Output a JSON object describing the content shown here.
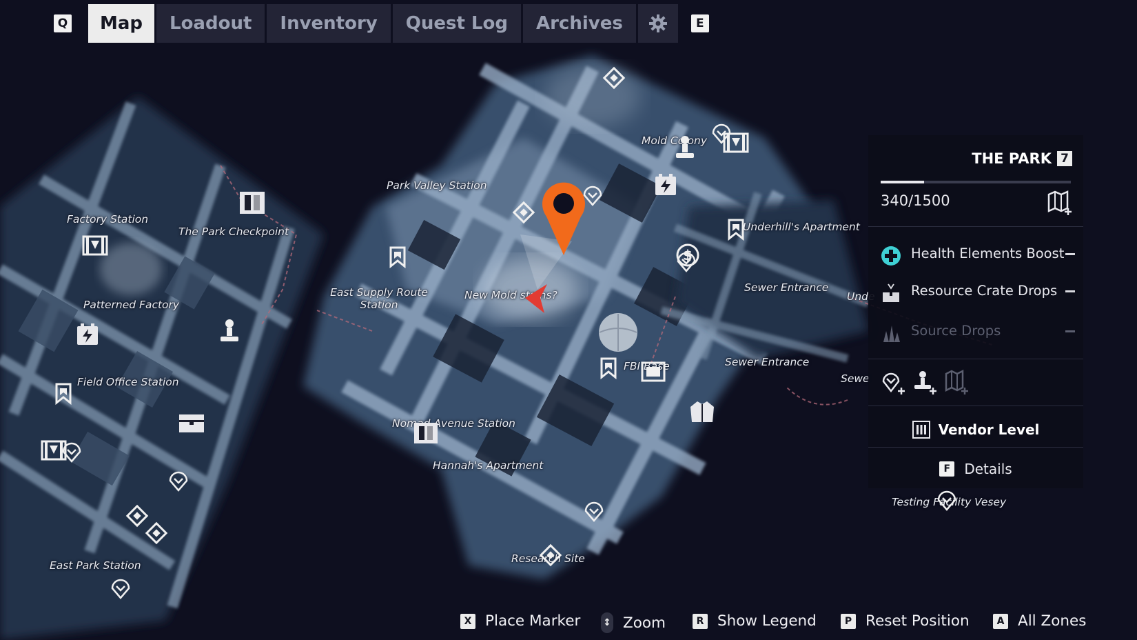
{
  "tabs": {
    "prev_key": "Q",
    "next_key": "E",
    "items": [
      {
        "label": "Map"
      },
      {
        "label": "Loadout"
      },
      {
        "label": "Inventory"
      },
      {
        "label": "Quest Log"
      },
      {
        "label": "Archives"
      }
    ],
    "active": "Map",
    "settings_icon": "gear-icon"
  },
  "map": {
    "labels": {
      "mold_colony": "Mold Colony",
      "park_valley_station": "Park Valley Station",
      "factory_station": "Factory Station",
      "park_checkpoint": "The Park Checkpoint",
      "underhills_apartment": "Underhill's Apartment",
      "patterned_factory": "Patterned Factory",
      "east_supply_route_station": "East Supply Route Station",
      "new_mold_stains": "New Mold stains?",
      "sewer_entrance_1": "Sewer Entrance",
      "sewer_entrance_2": "Sewer Entrance",
      "unde_partial": "Unde",
      "sewe_partial": "Sewe",
      "fbi_base": "FBI Base",
      "field_office_station": "Field Office Station",
      "nomad_avenue_station": "Nomad Avenue Station",
      "hannahs_apartment": "Hannah's Apartment",
      "testing_facility_vesey": "Testing Facility Vesey",
      "east_park_station": "East Park Station",
      "research_site": "Research Site"
    },
    "colors": {
      "background": "#0e0f1f",
      "terrain": "#8ea3bc",
      "waypoint": "#f26a1b",
      "player": "#e23b32"
    }
  },
  "panel": {
    "zone_name": "THE PARK",
    "zone_level": "7",
    "progress_text": "340/1500",
    "progress_fraction": 0.2267,
    "rewards": [
      {
        "label": "Health Elements Boost",
        "icon": "health-plus-icon",
        "dim": false
      },
      {
        "label": "Resource Crate Drops",
        "icon": "crate-icon",
        "dim": false
      },
      {
        "label": "Source Drops",
        "icon": "source-crystal-icon",
        "dim": true
      }
    ],
    "vendor_label": "Vendor Level",
    "details_key": "F",
    "details_label": "Details"
  },
  "hints": [
    {
      "key": "X",
      "label": "Place Marker"
    },
    {
      "key": "↕",
      "label": "Zoom"
    },
    {
      "key": "R",
      "label": "Show Legend"
    },
    {
      "key": "P",
      "label": "Reset Position"
    },
    {
      "key": "A",
      "label": "All Zones"
    }
  ]
}
